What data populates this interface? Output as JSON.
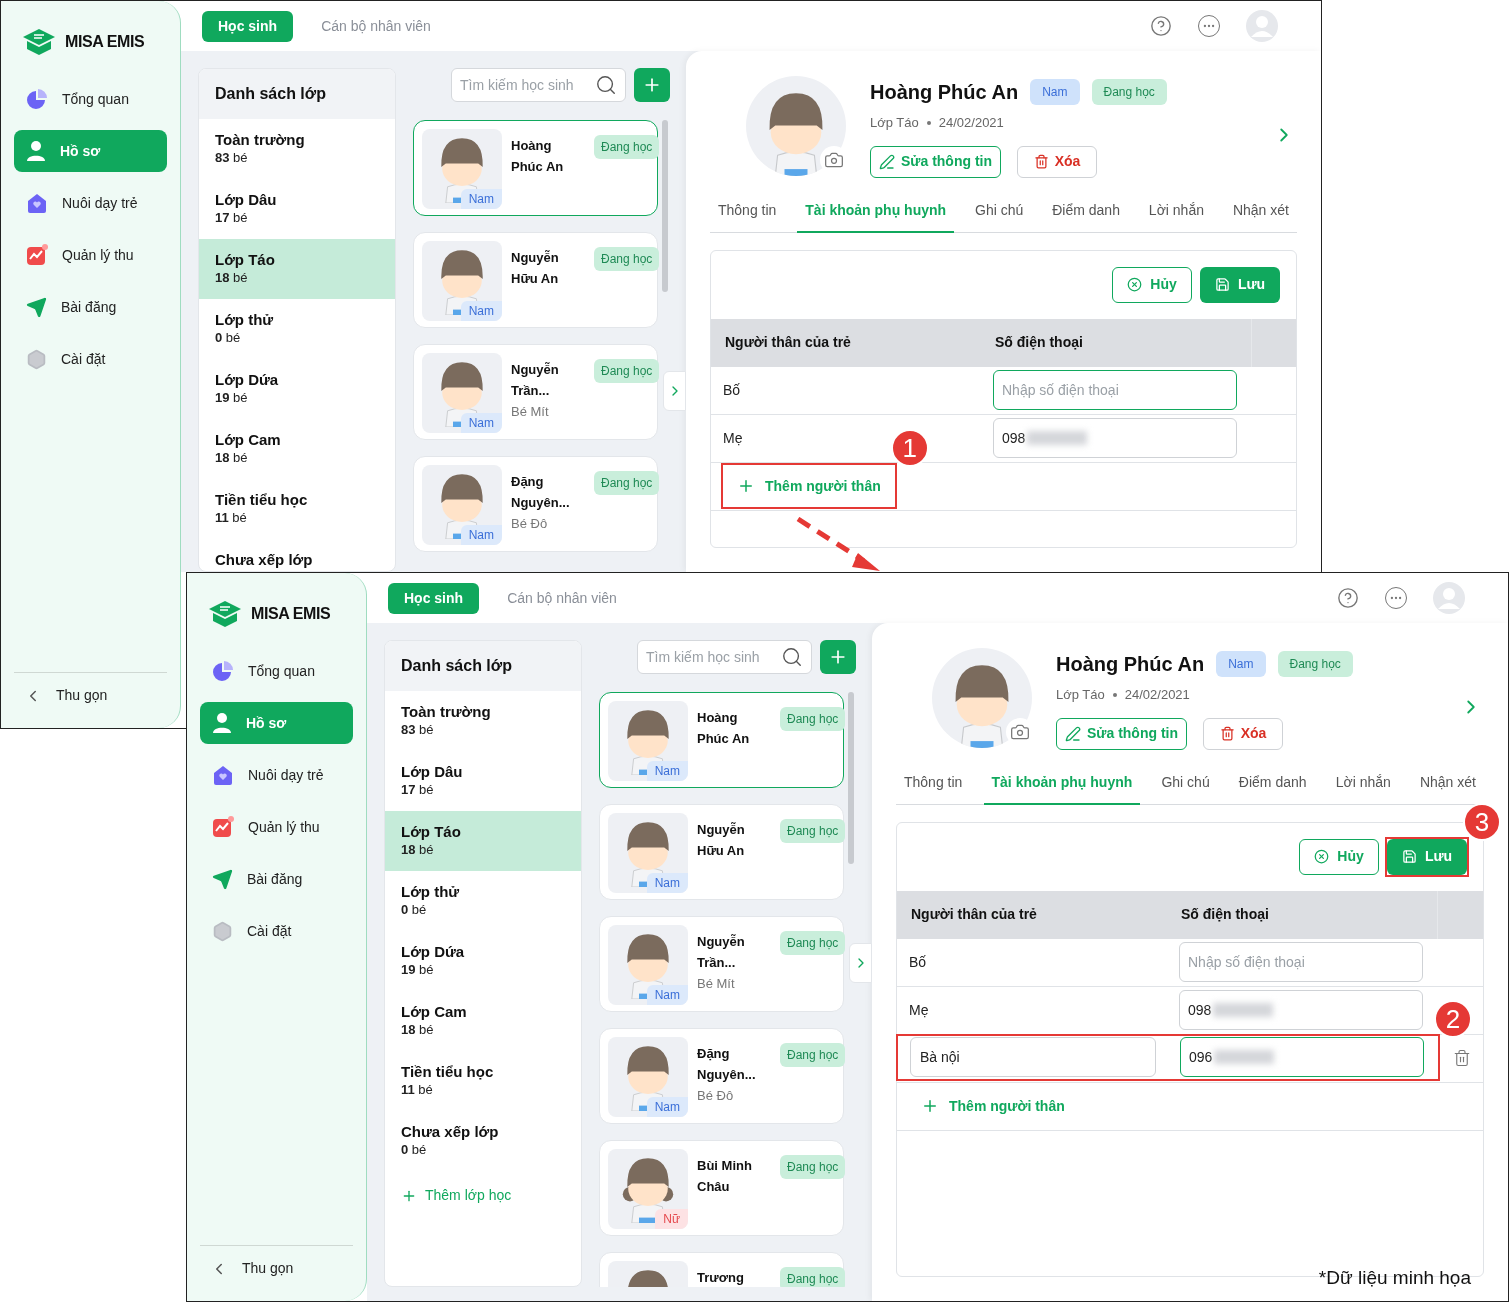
{
  "screens": [
    {
      "logo": "MISA EMIS",
      "nav": [
        {
          "label": "Tổng quan",
          "kind": "chart",
          "selected": false
        },
        {
          "label": "Hồ sơ",
          "kind": "person",
          "selected": true
        },
        {
          "label": "Nuôi dạy trẻ",
          "kind": "house",
          "selected": false
        },
        {
          "label": "Quản lý thu",
          "kind": "finance",
          "selected": false
        },
        {
          "label": "Bài đăng",
          "kind": "send",
          "selected": false
        },
        {
          "label": "Cài đặt",
          "kind": "settings",
          "selected": false
        }
      ],
      "collapse": "Thu gọn",
      "top_tabs": [
        {
          "label": "Học sinh",
          "selected": true
        },
        {
          "label": "Cán bộ nhân viên",
          "selected": false
        }
      ],
      "class_list": {
        "title": "Danh sách lớp",
        "items": [
          {
            "name": "Toàn trường",
            "count": "**83** bé",
            "selected": false
          },
          {
            "name": "Lớp Dâu",
            "count": "**17** bé",
            "selected": false
          },
          {
            "name": "Lớp Táo",
            "count": "**18** bé",
            "selected": true
          },
          {
            "name": "Lớp thử",
            "count": "**0** bé",
            "selected": false
          },
          {
            "name": "Lớp Dứa",
            "count": "**19** bé",
            "selected": false
          },
          {
            "name": "Lớp Cam",
            "count": "**18** bé",
            "selected": false
          },
          {
            "name": "Tiền tiểu học",
            "count": "**11** bé",
            "selected": false
          },
          {
            "name": "Chưa xếp lớp",
            "selected": false
          }
        ]
      },
      "search": {
        "placeholder": "Tìm kiếm học sinh"
      },
      "students": [
        {
          "name": "Hoàng Phúc An",
          "status": "Đang học",
          "gender": "Nam",
          "kind": "boy",
          "selected": true
        },
        {
          "name": "Nguyễn Hữu An",
          "status": "Đang học",
          "gender": "Nam",
          "kind": "boy",
          "selected": false
        },
        {
          "name": "Nguyễn Trần...",
          "nickname": "Bé Mít",
          "status": "Đang học",
          "gender": "Nam",
          "kind": "boy",
          "selected": false
        },
        {
          "name": "Đặng Nguyên...",
          "nickname": "Bé Đô",
          "status": "Đang học",
          "gender": "Nam",
          "kind": "boy",
          "selected": false
        }
      ],
      "profile": {
        "name": "Hoàng Phúc An",
        "gender": "Nam",
        "status": "Đang học",
        "class": "Lớp Táo",
        "dob": "24/02/2021",
        "edit": "Sửa thông tin",
        "delete": "Xóa",
        "tabs": [
          {
            "label": "Thông tin",
            "selected": false
          },
          {
            "label": "Tài khoản phụ huynh",
            "selected": true
          },
          {
            "label": "Ghi chú",
            "selected": false
          },
          {
            "label": "Điểm danh",
            "selected": false
          },
          {
            "label": "Lời nhắn",
            "selected": false
          },
          {
            "label": "Nhận xét",
            "selected": false
          }
        ],
        "cancel": "Hủy",
        "save": "Lưu",
        "columns": [
          "Người thân của trẻ",
          "Số điện thoại"
        ],
        "rows": [
          {
            "relation": "Bố",
            "kind": "text",
            "phone_placeholder": "Nhập số điện thoại",
            "focused": true
          },
          {
            "relation": "Mẹ",
            "kind": "text",
            "phone": "098",
            "blurred": true,
            "focused": false
          }
        ],
        "add_relative": "Thêm người thân",
        "add_relative_step": "1"
      },
      "next_step_arrow": true
    },
    {
      "logo": "MISA EMIS",
      "nav": [
        {
          "label": "Tổng quan",
          "kind": "chart",
          "selected": false
        },
        {
          "label": "Hồ sơ",
          "kind": "person",
          "selected": true
        },
        {
          "label": "Nuôi dạy trẻ",
          "kind": "house",
          "selected": false
        },
        {
          "label": "Quản lý thu",
          "kind": "finance",
          "selected": false
        },
        {
          "label": "Bài đăng",
          "kind": "send",
          "selected": false
        },
        {
          "label": "Cài đặt",
          "kind": "settings",
          "selected": false
        }
      ],
      "collapse": "Thu gọn",
      "top_tabs": [
        {
          "label": "Học sinh",
          "selected": true
        },
        {
          "label": "Cán bộ nhân viên",
          "selected": false
        }
      ],
      "class_list": {
        "title": "Danh sách lớp",
        "items": [
          {
            "name": "Toàn trường",
            "count": "**83** bé",
            "selected": false
          },
          {
            "name": "Lớp Dâu",
            "count": "**17** bé",
            "selected": false
          },
          {
            "name": "Lớp Táo",
            "count": "**18** bé",
            "selected": true
          },
          {
            "name": "Lớp thử",
            "count": "**0** bé",
            "selected": false
          },
          {
            "name": "Lớp Dứa",
            "count": "**19** bé",
            "selected": false
          },
          {
            "name": "Lớp Cam",
            "count": "**18** bé",
            "selected": false
          },
          {
            "name": "Tiền tiểu học",
            "count": "**11** bé",
            "selected": false
          },
          {
            "name": "Chưa xếp lớp",
            "count": "**0** bé",
            "selected": false
          }
        ],
        "add_class": "Thêm lớp học"
      },
      "search": {
        "placeholder": "Tìm kiếm học sinh"
      },
      "students": [
        {
          "name": "Hoàng Phúc An",
          "status": "Đang học",
          "gender": "Nam",
          "kind": "boy",
          "selected": true
        },
        {
          "name": "Nguyễn Hữu An",
          "status": "Đang học",
          "gender": "Nam",
          "kind": "boy",
          "selected": false
        },
        {
          "name": "Nguyễn Trần...",
          "nickname": "Bé Mít",
          "status": "Đang học",
          "gender": "Nam",
          "kind": "boy",
          "selected": false
        },
        {
          "name": "Đặng Nguyên...",
          "nickname": "Bé Đô",
          "status": "Đang học",
          "gender": "Nam",
          "kind": "boy",
          "selected": false
        },
        {
          "name": "Bùi Minh Châu",
          "status": "Đang học",
          "gender": "Nữ",
          "kind": "girl",
          "selected": false
        },
        {
          "name": "Trương",
          "status": "Đang học",
          "kind": "boy",
          "selected": false
        }
      ],
      "profile": {
        "name": "Hoàng Phúc An",
        "gender": "Nam",
        "status": "Đang học",
        "class": "Lớp Táo",
        "dob": "24/02/2021",
        "edit": "Sửa thông tin",
        "delete": "Xóa",
        "tabs": [
          {
            "label": "Thông tin",
            "selected": false
          },
          {
            "label": "Tài khoản phụ huynh",
            "selected": true
          },
          {
            "label": "Ghi chú",
            "selected": false
          },
          {
            "label": "Điểm danh",
            "selected": false
          },
          {
            "label": "Lời nhắn",
            "selected": false
          },
          {
            "label": "Nhận xét",
            "selected": false
          }
        ],
        "cancel": "Hủy",
        "save": "Lưu",
        "save_step": "3",
        "columns": [
          "Người thân của trẻ",
          "Số điện thoại"
        ],
        "rows": [
          {
            "relation": "Bố",
            "kind": "text",
            "phone_placeholder": "Nhập số điện thoại",
            "focused": false
          },
          {
            "relation": "Mẹ",
            "kind": "text",
            "phone": "098",
            "blurred": true,
            "focused": false
          },
          {
            "relation": "Bà nội",
            "kind": "input",
            "phone": "096",
            "blurred": true,
            "focused": true,
            "deletable": true,
            "step": "2"
          }
        ],
        "add_relative": "Thêm người thân"
      },
      "next_step_arrow": false
    }
  ],
  "footnote": "*Dữ liệu minh họa"
}
